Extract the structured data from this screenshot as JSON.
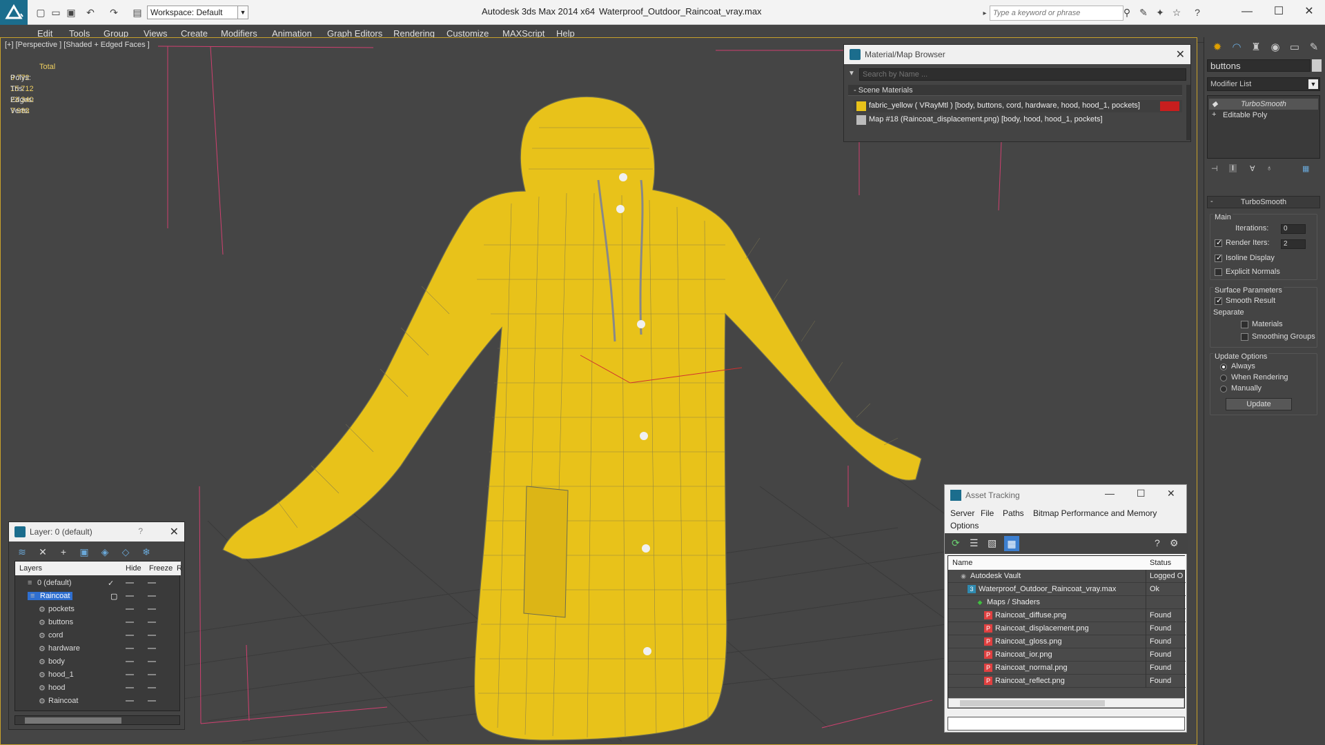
{
  "titlebar": {
    "workspace": "Workspace: Default",
    "app_title": "Autodesk 3ds Max  2014 x64",
    "file_title": "Waterproof_Outdoor_Raincoat_vray.max",
    "search_placeholder": "Type a keyword or phrase"
  },
  "menu": [
    "Edit",
    "Tools",
    "Group",
    "Views",
    "Create",
    "Modifiers",
    "Animation",
    "Graph Editors",
    "Rendering",
    "Customize",
    "MAXScript",
    "Help"
  ],
  "viewport": {
    "label": "[+] [Perspective ] [Shaded + Edged Faces ]",
    "stats": {
      "total_label": "Total",
      "rows": [
        {
          "label": "Polys:",
          "value": "9 772"
        },
        {
          "label": "Tris:",
          "value": "15 712"
        },
        {
          "label": "Edges:",
          "value": "23 340"
        },
        {
          "label": "Verts:",
          "value": "7 983"
        }
      ]
    },
    "model_color": "#e8c21a",
    "wire_color": "#6b6b50"
  },
  "material_browser": {
    "title": "Material/Map Browser",
    "search_placeholder": "Search by Name ...",
    "section": "Scene Materials",
    "rows": [
      "fabric_yellow ( VRayMtl ) [body, buttons, cord, hardware, hood, hood_1, pockets]",
      "Map #18 (Raincoat_displacement.png) [body, hood, hood_1, pockets]"
    ]
  },
  "command_panel": {
    "object_name": "buttons",
    "modifier_list": "Modifier List",
    "stack": [
      "TurboSmooth",
      "Editable Poly"
    ],
    "rollout": "TurboSmooth",
    "main_label": "Main",
    "iterations_label": "Iterations:",
    "iterations_value": "0",
    "render_iters_label": "Render Iters:",
    "render_iters_value": "2",
    "isoline_label": "Isoline Display",
    "explicit_normals_label": "Explicit Normals",
    "surface_params_label": "Surface Parameters",
    "smooth_result_label": "Smooth Result",
    "separate_label": "Separate",
    "materials_label": "Materials",
    "smoothing_groups_label": "Smoothing Groups",
    "update_options_label": "Update Options",
    "always_label": "Always",
    "when_rendering_label": "When Rendering",
    "manually_label": "Manually",
    "update_button": "Update"
  },
  "layer_panel": {
    "title": "Layer: 0 (default)",
    "help": "?",
    "col_layers": "Layers",
    "col_hide": "Hide",
    "col_freeze": "Freeze",
    "col_r": "R",
    "rows": [
      {
        "name": "0 (default)",
        "indent": 0
      },
      {
        "name": "Raincoat",
        "indent": 0
      },
      {
        "name": "pockets",
        "indent": 1
      },
      {
        "name": "buttons",
        "indent": 1
      },
      {
        "name": "cord",
        "indent": 1
      },
      {
        "name": "hardware",
        "indent": 1
      },
      {
        "name": "body",
        "indent": 1
      },
      {
        "name": "hood_1",
        "indent": 1
      },
      {
        "name": "hood",
        "indent": 1
      },
      {
        "name": "Raincoat",
        "indent": 1
      }
    ]
  },
  "asset_tracking": {
    "title": "Asset Tracking",
    "menu": [
      "Server",
      "File",
      "Paths",
      "Bitmap Performance and Memory",
      "Options"
    ],
    "col_name": "Name",
    "col_status": "Status",
    "rows": [
      {
        "name": "Autodesk Vault",
        "status": "Logged O",
        "indent": 1
      },
      {
        "name": "Waterproof_Outdoor_Raincoat_vray.max",
        "status": "Ok",
        "indent": 2
      },
      {
        "name": "Maps / Shaders",
        "status": "",
        "indent": 3
      },
      {
        "name": "Raincoat_diffuse.png",
        "status": "Found",
        "indent": 4
      },
      {
        "name": "Raincoat_displacement.png",
        "status": "Found",
        "indent": 4
      },
      {
        "name": "Raincoat_gloss.png",
        "status": "Found",
        "indent": 4
      },
      {
        "name": "Raincoat_ior.png",
        "status": "Found",
        "indent": 4
      },
      {
        "name": "Raincoat_normal.png",
        "status": "Found",
        "indent": 4
      },
      {
        "name": "Raincoat_reflect.png",
        "status": "Found",
        "indent": 4
      }
    ]
  }
}
